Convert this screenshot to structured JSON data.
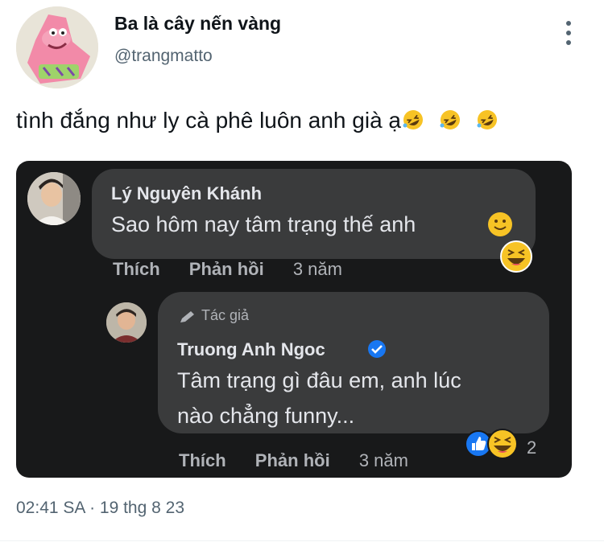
{
  "tweet": {
    "display_name": "Ba là cây nến vàng",
    "handle": "@trangmatto",
    "text": "tình đắng như ly cà phê luôn anh già ạ",
    "timestamp": "02:41 SA · 19 thg 8 23",
    "avatar_icon": "patrick-star-avatar",
    "inline_emojis": [
      "rolling-on-floor-laughing",
      "rolling-on-floor-laughing",
      "rolling-on-floor-laughing"
    ]
  },
  "screenshot": {
    "comment1": {
      "author": "Lý Nguyên Khánh",
      "text": "Sao hôm nay tâm trạng thế anh",
      "like": "Thích",
      "reply": "Phản hồi",
      "age": "3 năm"
    },
    "comment2": {
      "badge": "Tác giả",
      "author": "Truong Anh Ngoc",
      "text_line1": "Tâm trạng gì đâu em, anh lúc",
      "text_line2": "nào chẳng funny...",
      "like": "Thích",
      "reply": "Phản hồi",
      "age": "3 năm",
      "reaction_count": "2"
    }
  },
  "colors": {
    "fb_background": "#18191a",
    "fb_bubble": "#3a3b3c",
    "fb_text": "#e4e6eb",
    "fb_meta": "#b0b3b8",
    "verified_blue": "#1877f2",
    "twitter_secondary": "#536471"
  }
}
